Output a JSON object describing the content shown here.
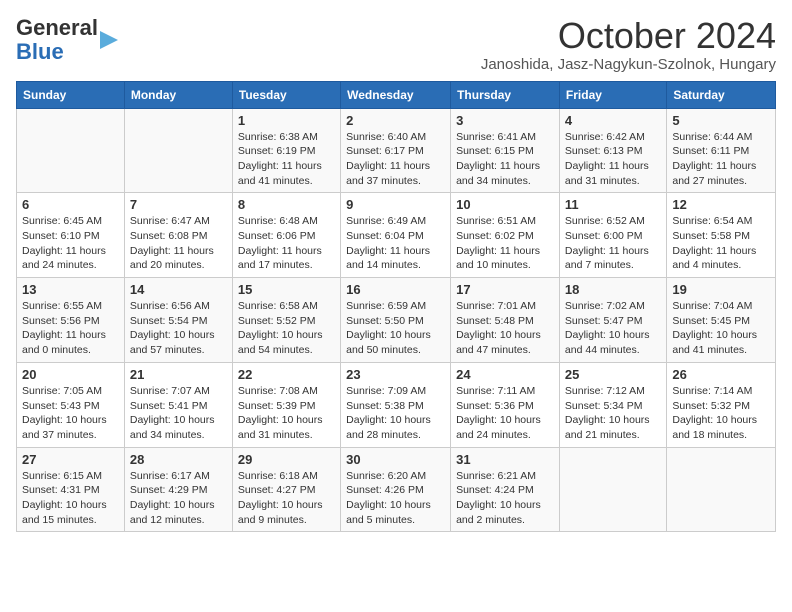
{
  "header": {
    "logo_line1": "General",
    "logo_line2": "Blue",
    "title": "October 2024",
    "subtitle": "Janoshida, Jasz-Nagykun-Szolnok, Hungary"
  },
  "days_of_week": [
    "Sunday",
    "Monday",
    "Tuesday",
    "Wednesday",
    "Thursday",
    "Friday",
    "Saturday"
  ],
  "weeks": [
    [
      {
        "day": "",
        "info": ""
      },
      {
        "day": "",
        "info": ""
      },
      {
        "day": "1",
        "info": "Sunrise: 6:38 AM\nSunset: 6:19 PM\nDaylight: 11 hours and 41 minutes."
      },
      {
        "day": "2",
        "info": "Sunrise: 6:40 AM\nSunset: 6:17 PM\nDaylight: 11 hours and 37 minutes."
      },
      {
        "day": "3",
        "info": "Sunrise: 6:41 AM\nSunset: 6:15 PM\nDaylight: 11 hours and 34 minutes."
      },
      {
        "day": "4",
        "info": "Sunrise: 6:42 AM\nSunset: 6:13 PM\nDaylight: 11 hours and 31 minutes."
      },
      {
        "day": "5",
        "info": "Sunrise: 6:44 AM\nSunset: 6:11 PM\nDaylight: 11 hours and 27 minutes."
      }
    ],
    [
      {
        "day": "6",
        "info": "Sunrise: 6:45 AM\nSunset: 6:10 PM\nDaylight: 11 hours and 24 minutes."
      },
      {
        "day": "7",
        "info": "Sunrise: 6:47 AM\nSunset: 6:08 PM\nDaylight: 11 hours and 20 minutes."
      },
      {
        "day": "8",
        "info": "Sunrise: 6:48 AM\nSunset: 6:06 PM\nDaylight: 11 hours and 17 minutes."
      },
      {
        "day": "9",
        "info": "Sunrise: 6:49 AM\nSunset: 6:04 PM\nDaylight: 11 hours and 14 minutes."
      },
      {
        "day": "10",
        "info": "Sunrise: 6:51 AM\nSunset: 6:02 PM\nDaylight: 11 hours and 10 minutes."
      },
      {
        "day": "11",
        "info": "Sunrise: 6:52 AM\nSunset: 6:00 PM\nDaylight: 11 hours and 7 minutes."
      },
      {
        "day": "12",
        "info": "Sunrise: 6:54 AM\nSunset: 5:58 PM\nDaylight: 11 hours and 4 minutes."
      }
    ],
    [
      {
        "day": "13",
        "info": "Sunrise: 6:55 AM\nSunset: 5:56 PM\nDaylight: 11 hours and 0 minutes."
      },
      {
        "day": "14",
        "info": "Sunrise: 6:56 AM\nSunset: 5:54 PM\nDaylight: 10 hours and 57 minutes."
      },
      {
        "day": "15",
        "info": "Sunrise: 6:58 AM\nSunset: 5:52 PM\nDaylight: 10 hours and 54 minutes."
      },
      {
        "day": "16",
        "info": "Sunrise: 6:59 AM\nSunset: 5:50 PM\nDaylight: 10 hours and 50 minutes."
      },
      {
        "day": "17",
        "info": "Sunrise: 7:01 AM\nSunset: 5:48 PM\nDaylight: 10 hours and 47 minutes."
      },
      {
        "day": "18",
        "info": "Sunrise: 7:02 AM\nSunset: 5:47 PM\nDaylight: 10 hours and 44 minutes."
      },
      {
        "day": "19",
        "info": "Sunrise: 7:04 AM\nSunset: 5:45 PM\nDaylight: 10 hours and 41 minutes."
      }
    ],
    [
      {
        "day": "20",
        "info": "Sunrise: 7:05 AM\nSunset: 5:43 PM\nDaylight: 10 hours and 37 minutes."
      },
      {
        "day": "21",
        "info": "Sunrise: 7:07 AM\nSunset: 5:41 PM\nDaylight: 10 hours and 34 minutes."
      },
      {
        "day": "22",
        "info": "Sunrise: 7:08 AM\nSunset: 5:39 PM\nDaylight: 10 hours and 31 minutes."
      },
      {
        "day": "23",
        "info": "Sunrise: 7:09 AM\nSunset: 5:38 PM\nDaylight: 10 hours and 28 minutes."
      },
      {
        "day": "24",
        "info": "Sunrise: 7:11 AM\nSunset: 5:36 PM\nDaylight: 10 hours and 24 minutes."
      },
      {
        "day": "25",
        "info": "Sunrise: 7:12 AM\nSunset: 5:34 PM\nDaylight: 10 hours and 21 minutes."
      },
      {
        "day": "26",
        "info": "Sunrise: 7:14 AM\nSunset: 5:32 PM\nDaylight: 10 hours and 18 minutes."
      }
    ],
    [
      {
        "day": "27",
        "info": "Sunrise: 6:15 AM\nSunset: 4:31 PM\nDaylight: 10 hours and 15 minutes."
      },
      {
        "day": "28",
        "info": "Sunrise: 6:17 AM\nSunset: 4:29 PM\nDaylight: 10 hours and 12 minutes."
      },
      {
        "day": "29",
        "info": "Sunrise: 6:18 AM\nSunset: 4:27 PM\nDaylight: 10 hours and 9 minutes."
      },
      {
        "day": "30",
        "info": "Sunrise: 6:20 AM\nSunset: 4:26 PM\nDaylight: 10 hours and 5 minutes."
      },
      {
        "day": "31",
        "info": "Sunrise: 6:21 AM\nSunset: 4:24 PM\nDaylight: 10 hours and 2 minutes."
      },
      {
        "day": "",
        "info": ""
      },
      {
        "day": "",
        "info": ""
      }
    ]
  ]
}
